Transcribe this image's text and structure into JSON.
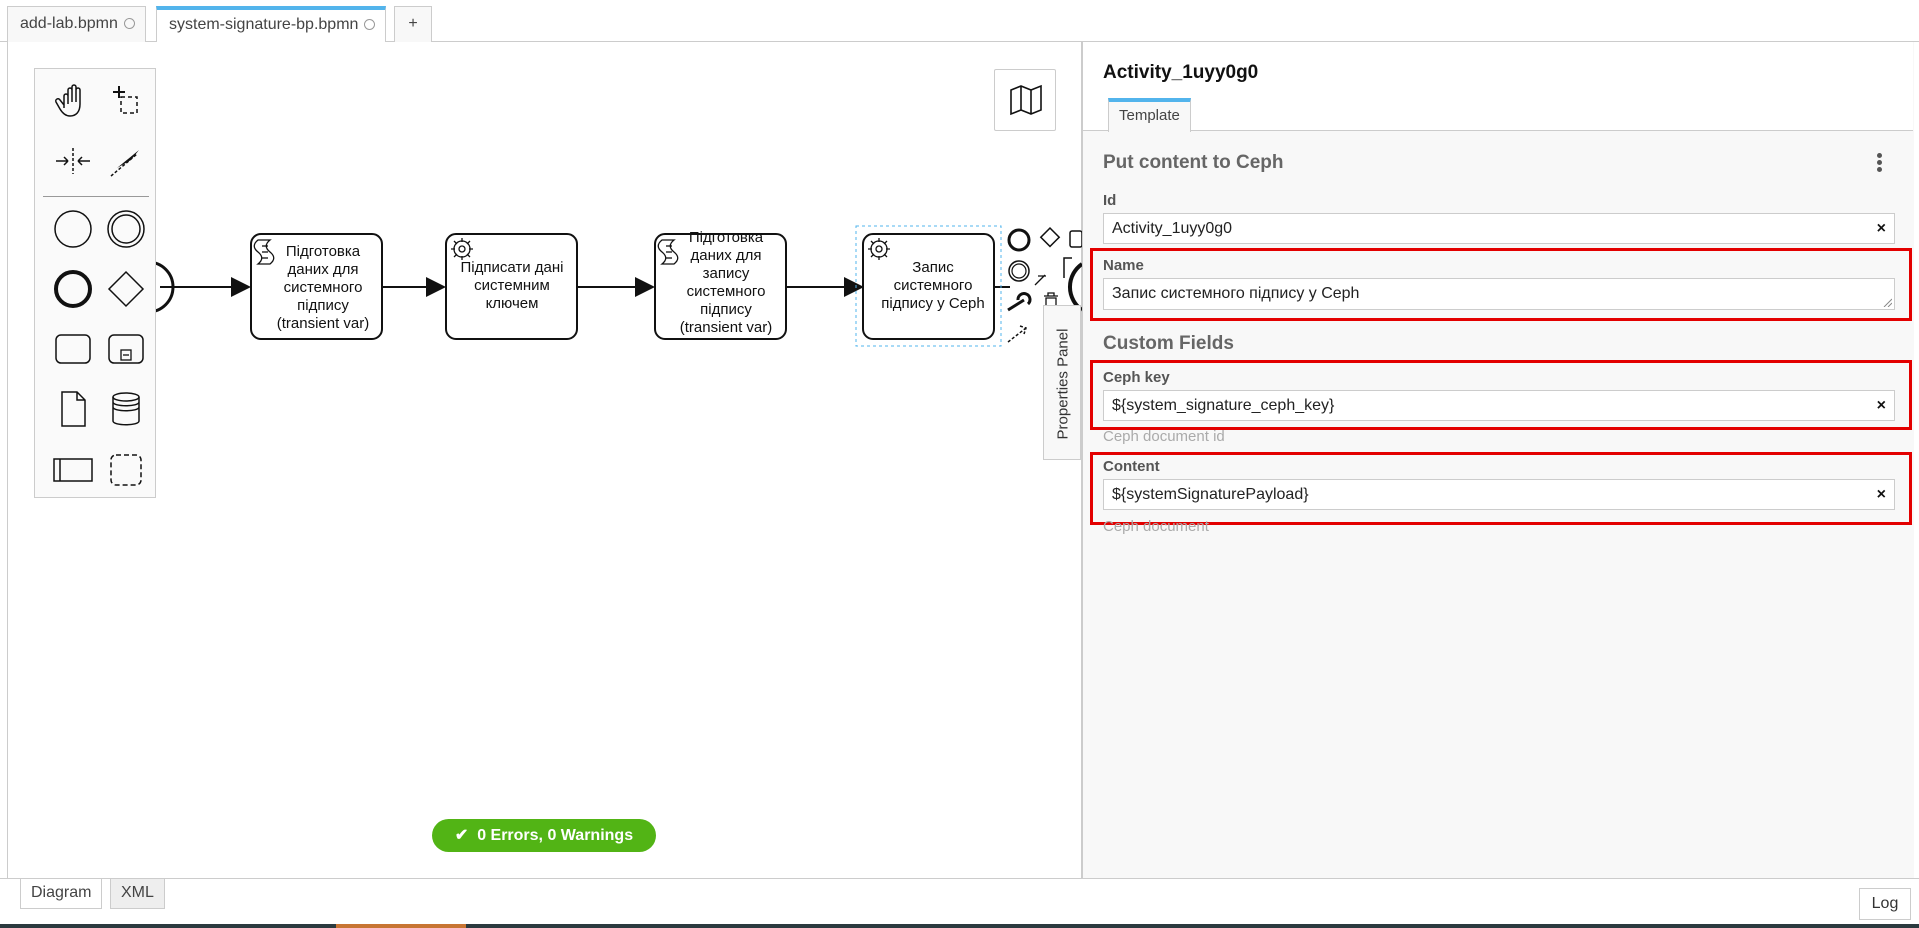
{
  "file_tabs": [
    {
      "label": "add-lab.bpmn"
    },
    {
      "label": "system-signature-bp.bpmn"
    }
  ],
  "add_tab_label": "+",
  "diagram": {
    "tasks": [
      {
        "label": "Підготовка даних для системного підпису (transient var)",
        "icon": "script-icon"
      },
      {
        "label": "Підписати дані системним ключем",
        "icon": "gear-icon"
      },
      {
        "label": "Підготовка даних для запису системного підпису (transient var)",
        "icon": "script-icon"
      },
      {
        "label": "Запис системного підпису у Ceph",
        "icon": "gear-icon"
      }
    ],
    "status_badge": "0 Errors, 0 Warnings"
  },
  "properties_toggle_label": "Properties Panel",
  "properties": {
    "title": "Activity_1uyy0g0",
    "tab": "Template",
    "group_title": "Put content to Ceph",
    "id_label": "Id",
    "id_value": "Activity_1uyy0g0",
    "name_label": "Name",
    "name_value": "Запис системного підпису у Ceph",
    "custom_fields_title": "Custom Fields",
    "ceph_key_label": "Ceph key",
    "ceph_key_value": "${system_signature_ceph_key}",
    "ceph_key_desc": "Ceph document id",
    "content_label": "Content",
    "content_value": "${systemSignaturePayload}",
    "content_desc": "Ceph document",
    "clear_glyph": "×"
  },
  "bottom_tabs": [
    {
      "label": "Diagram"
    },
    {
      "label": "XML"
    }
  ],
  "log_label": "Log",
  "colors": {
    "accent": "#52b4ec",
    "success": "#52b415",
    "highlight": "#e30000"
  }
}
